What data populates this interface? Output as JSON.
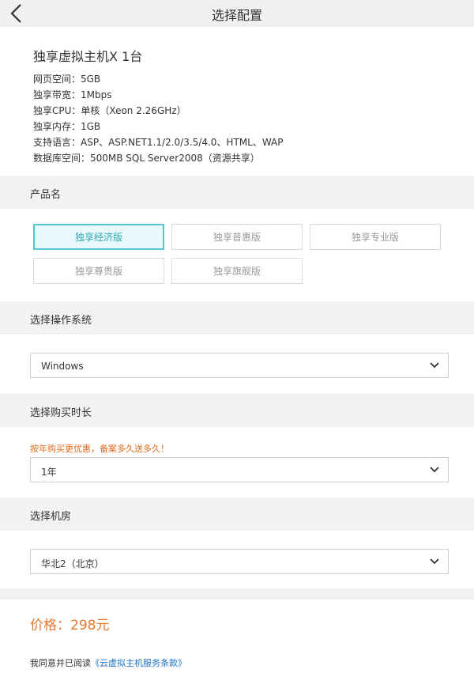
{
  "header": {
    "title": "选择配置"
  },
  "product": {
    "name": "独享虚拟主机X 1台",
    "specs": [
      "网页空间：5GB",
      "独享带宽：1Mbps",
      "独享CPU：单核（Xeon 2.26GHz）",
      "独享内存：1GB",
      "支持语言：ASP、ASP.NET1.1/2.0/3.5/4.0、HTML、WAP",
      "数据库空间：500MB SQL Server2008（资源共享）"
    ]
  },
  "edition": {
    "label": "产品名",
    "options": [
      "独享经济版",
      "独享普惠版",
      "独享专业版",
      "独享尊贵版",
      "独享旗舰版"
    ],
    "selected_index": 0
  },
  "os": {
    "label": "选择操作系统",
    "value": "Windows"
  },
  "duration": {
    "label": "选择购买时长",
    "promo": "按年购买更优惠，备案多久送多久！",
    "value": "1年"
  },
  "datacenter": {
    "label": "选择机房",
    "value": "华北2（北京）"
  },
  "price": {
    "text": "价格：298元"
  },
  "agreement": {
    "text": "我同意并已阅读",
    "link": "《云虚拟主机服务条款》"
  },
  "colors": {
    "accent": "#54c6cf",
    "price": "#e4792e",
    "promo": "#e26b1e",
    "link": "#1a72c4"
  }
}
